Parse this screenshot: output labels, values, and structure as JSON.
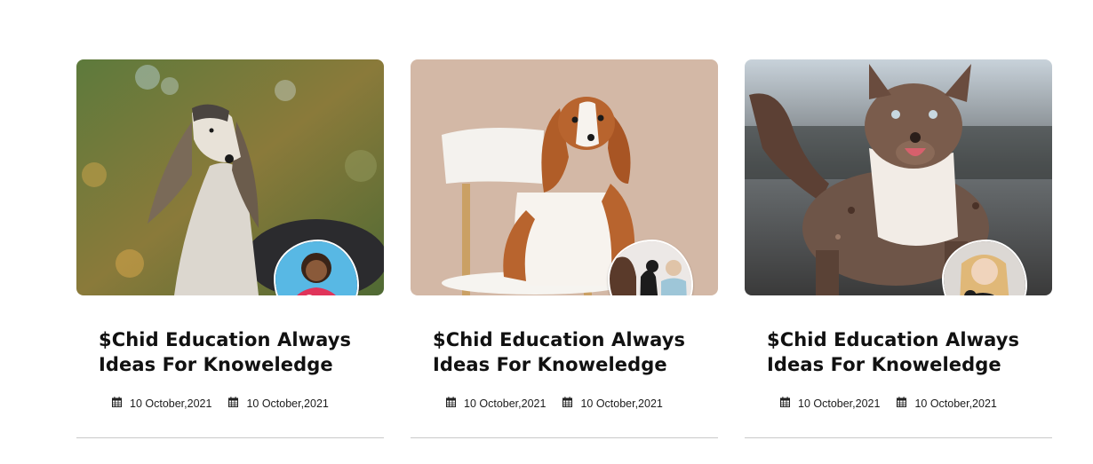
{
  "posts": [
    {
      "title": "$Chid Education Always Ideas For Knoweledge",
      "image_icon": "saluki-dog-photo",
      "author_icon": "woman-holding-puppy-avatar",
      "dates": [
        "10 October,2021",
        "10 October,2021"
      ]
    },
    {
      "title": "$Chid Education Always Ideas For Knoweledge",
      "image_icon": "spaniel-on-chair-photo",
      "author_icon": "women-with-dog-avatar",
      "dates": [
        "10 October,2021",
        "10 October,2021"
      ]
    },
    {
      "title": "$Chid Education Always Ideas For Knoweledge",
      "image_icon": "running-dog-photo",
      "author_icon": "woman-with-cat-avatar",
      "dates": [
        "10 October,2021",
        "10 October,2021"
      ]
    }
  ],
  "colors": {
    "title": "#111111",
    "meta_text": "#1c1c1c",
    "divider": "#c9c9c9"
  }
}
